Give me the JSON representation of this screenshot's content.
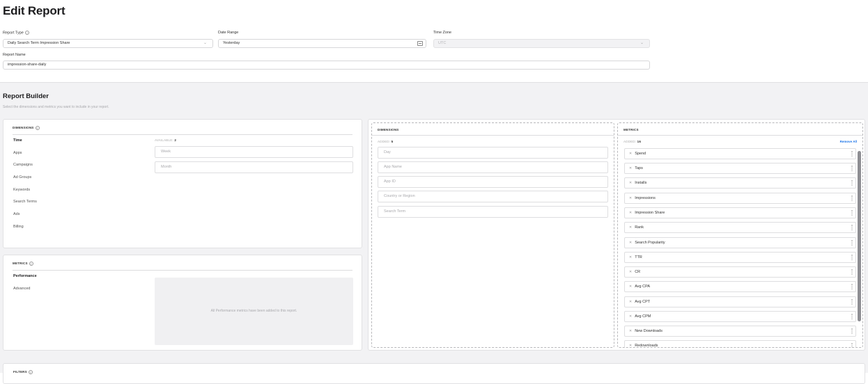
{
  "page": {
    "title": "Edit Report"
  },
  "form": {
    "report_type_label": "Report Type",
    "report_type_value": "Daily Search Term Impression Share",
    "date_range_label": "Date Range",
    "date_range_value": "Yesterday",
    "time_zone_label": "Time Zone",
    "time_zone_value": "UTC",
    "report_name_label": "Report Name",
    "report_name_value": "impression-share-daily"
  },
  "builder": {
    "title": "Report Builder",
    "subtitle": "Select the dimensions and metrics you want to include in your report.",
    "dimensions_panel": {
      "heading": "DIMENSIONS",
      "categories": [
        "Time",
        "Apps",
        "Campaigns",
        "Ad Groups",
        "Keywords",
        "Search Terms",
        "Ads",
        "Billing"
      ],
      "available_label": "AVAILABLE:",
      "available_count": "2",
      "options": [
        "Week",
        "Month"
      ]
    },
    "metrics_panel": {
      "heading": "METRICS",
      "categories": [
        "Performance",
        "Advanced"
      ],
      "empty_message": "All Performance metrics have been added to this report."
    },
    "selected_dimensions": {
      "heading": "DIMENSIONS",
      "added_label": "ADDED:",
      "added_count": "5",
      "items": [
        "Day",
        "App Name",
        "App ID",
        "Country or Region",
        "Search Term"
      ]
    },
    "selected_metrics": {
      "heading": "METRICS",
      "added_label": "ADDED:",
      "added_count": "16",
      "remove_all": "Remove All",
      "items": [
        "Spend",
        "Taps",
        "Installs",
        "Impressions",
        "Impression Share",
        "Rank",
        "Search Popularity",
        "TTR",
        "CR",
        "Avg CPA",
        "Avg CPT",
        "Avg CPM",
        "New Downloads",
        "Redownloads"
      ]
    },
    "filters_heading": "FILTERS"
  },
  "icons": {
    "help": "help-circle-icon",
    "chevron": "chevron-down-icon",
    "calendar": "calendar-icon",
    "remove": "x-icon",
    "drag": "drag-handle-icon"
  }
}
